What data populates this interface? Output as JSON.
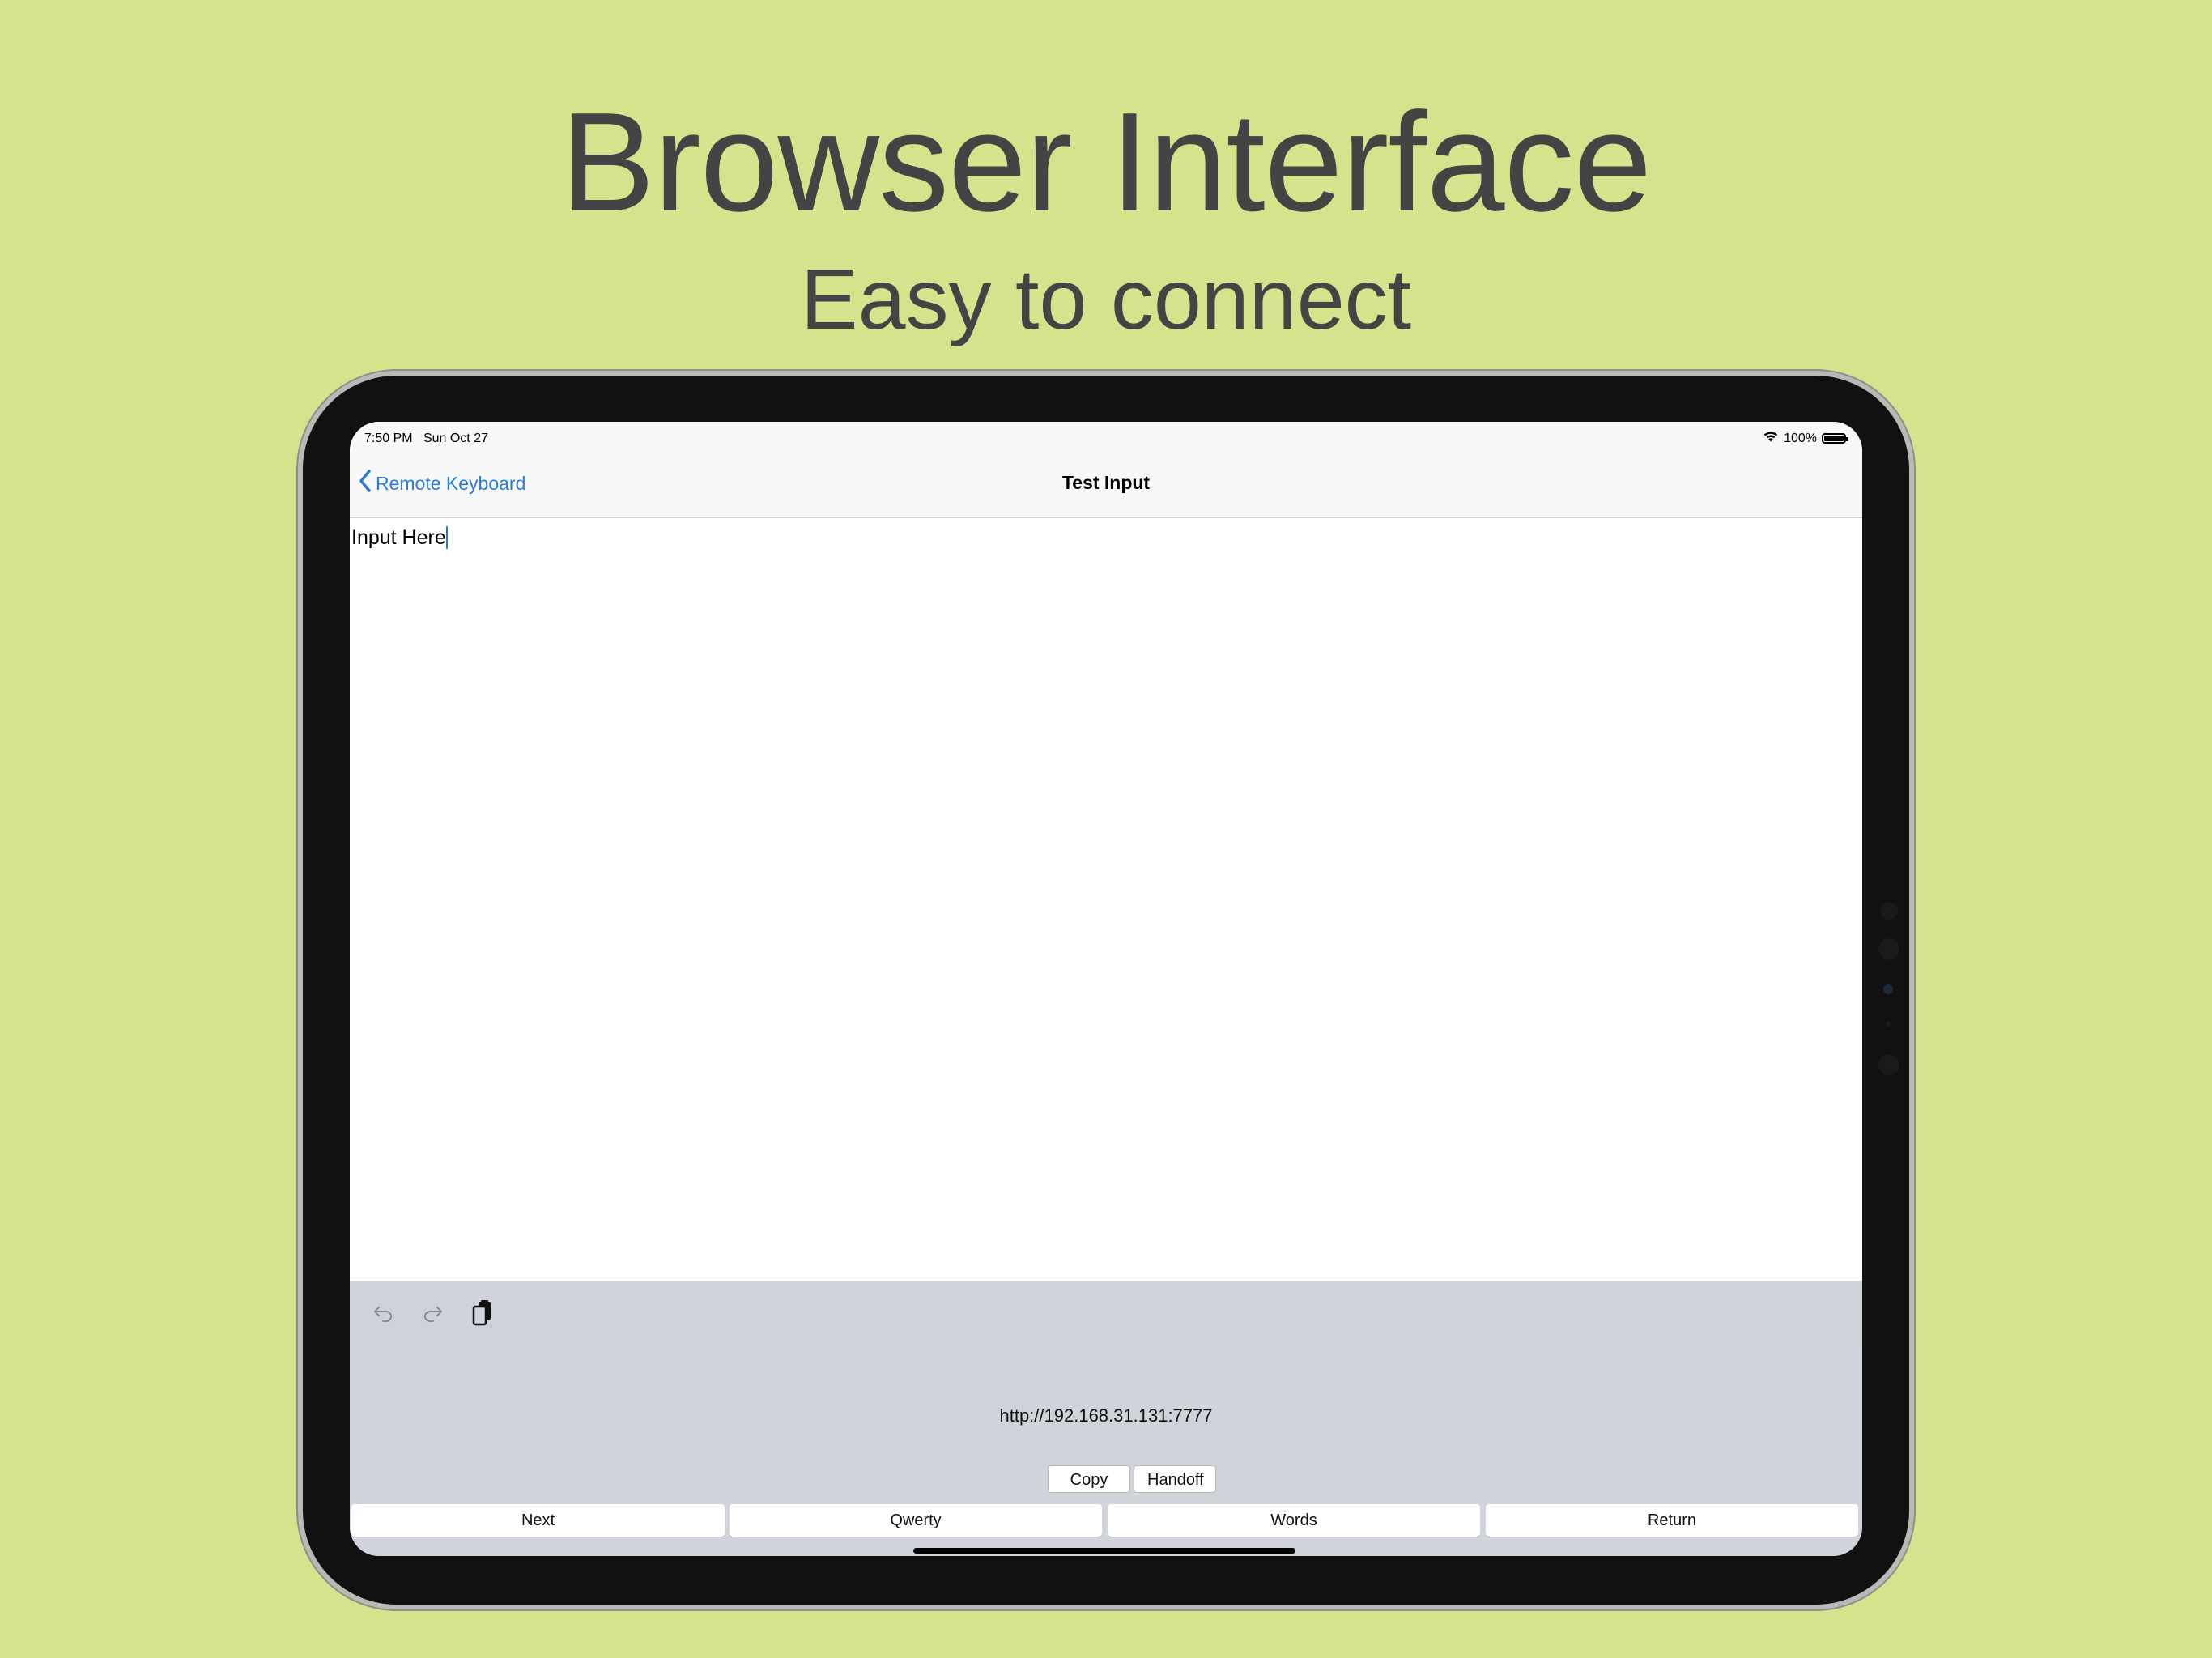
{
  "promo": {
    "title": "Browser Interface",
    "subtitle": "Easy to connect"
  },
  "status_bar": {
    "time": "7:50 PM",
    "date": "Sun Oct 27",
    "battery": "100%",
    "battery_level": 1.0,
    "icons": [
      "wifi-icon",
      "battery-icon"
    ]
  },
  "navbar": {
    "back_label": "Remote Keyboard",
    "title": "Test Input",
    "back_icon": "chevron-left-icon"
  },
  "editor": {
    "text": "Input Here"
  },
  "assist_bar": {
    "icons": [
      "undo-icon",
      "redo-icon",
      "paste-icon"
    ]
  },
  "web_panel": {
    "url": "http://192.168.31.131:7777",
    "copy_label": "Copy",
    "handoff_label": "Handoff"
  },
  "keys": {
    "next": "Next",
    "qwerty": "Qwerty",
    "words": "Words",
    "return": "Return"
  },
  "colors": {
    "background": "#d6e38c",
    "headline": "#434443",
    "accent": "#2a7cd8",
    "keyboard": "#d1d4dc"
  }
}
